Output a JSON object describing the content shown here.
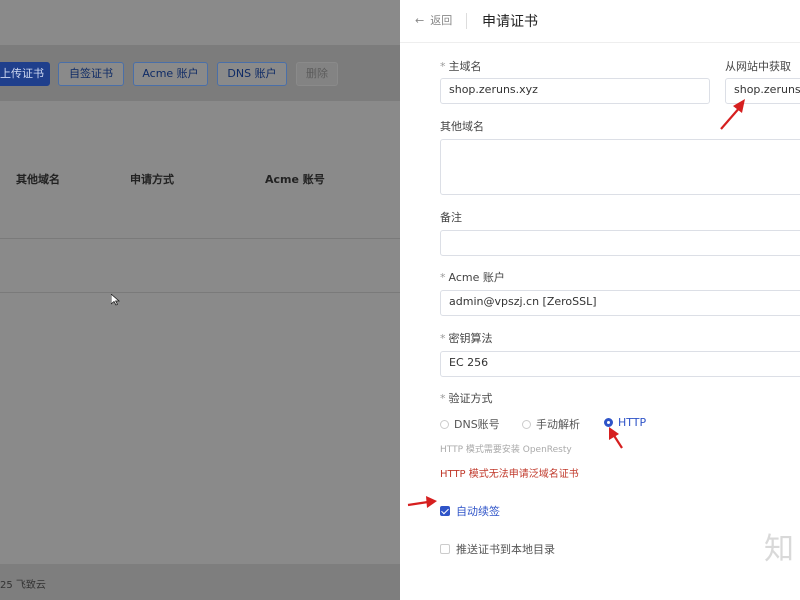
{
  "background": {
    "toolbar": {
      "upload_cert": "上传证书",
      "self_signed": "自签证书",
      "acme_account": "Acme 账户",
      "dns_account": "DNS 账户",
      "delete": "删除"
    },
    "table_headers": [
      "其他域名",
      "申请方式",
      "Acme 账号"
    ],
    "footer_text": "25 飞致云"
  },
  "drawer": {
    "back_label": "返回",
    "title": "申请证书",
    "primary_domain": {
      "label": "主域名",
      "value": "shop.zeruns.xyz"
    },
    "fetch_from_site": {
      "label": "从网站中获取",
      "value": "shop.zeruns.x"
    },
    "other_domains": {
      "label": "其他域名",
      "value": ""
    },
    "remark": {
      "label": "备注",
      "value": ""
    },
    "acme_account": {
      "label": "Acme 账户",
      "value": "admin@vpszj.cn [ZeroSSL]"
    },
    "key_algorithm": {
      "label": "密钥算法",
      "value": "EC 256"
    },
    "verify_method": {
      "label": "验证方式",
      "options": [
        "DNS账号",
        "手动解析",
        "HTTP"
      ],
      "selected": "HTTP"
    },
    "http_hint": "HTTP 模式需要安装 OpenResty",
    "http_warning": "HTTP 模式无法申请泛域名证书",
    "auto_renew": {
      "label": "自动续签",
      "checked": true
    },
    "push_local": {
      "label": "推送证书到本地目录",
      "checked": false
    },
    "watermark": "知"
  },
  "colors": {
    "accent": "#2f54c8",
    "warning": "#c0392b",
    "annotation_arrow": "#d61f1f",
    "overlay": "#8a8a8a"
  }
}
